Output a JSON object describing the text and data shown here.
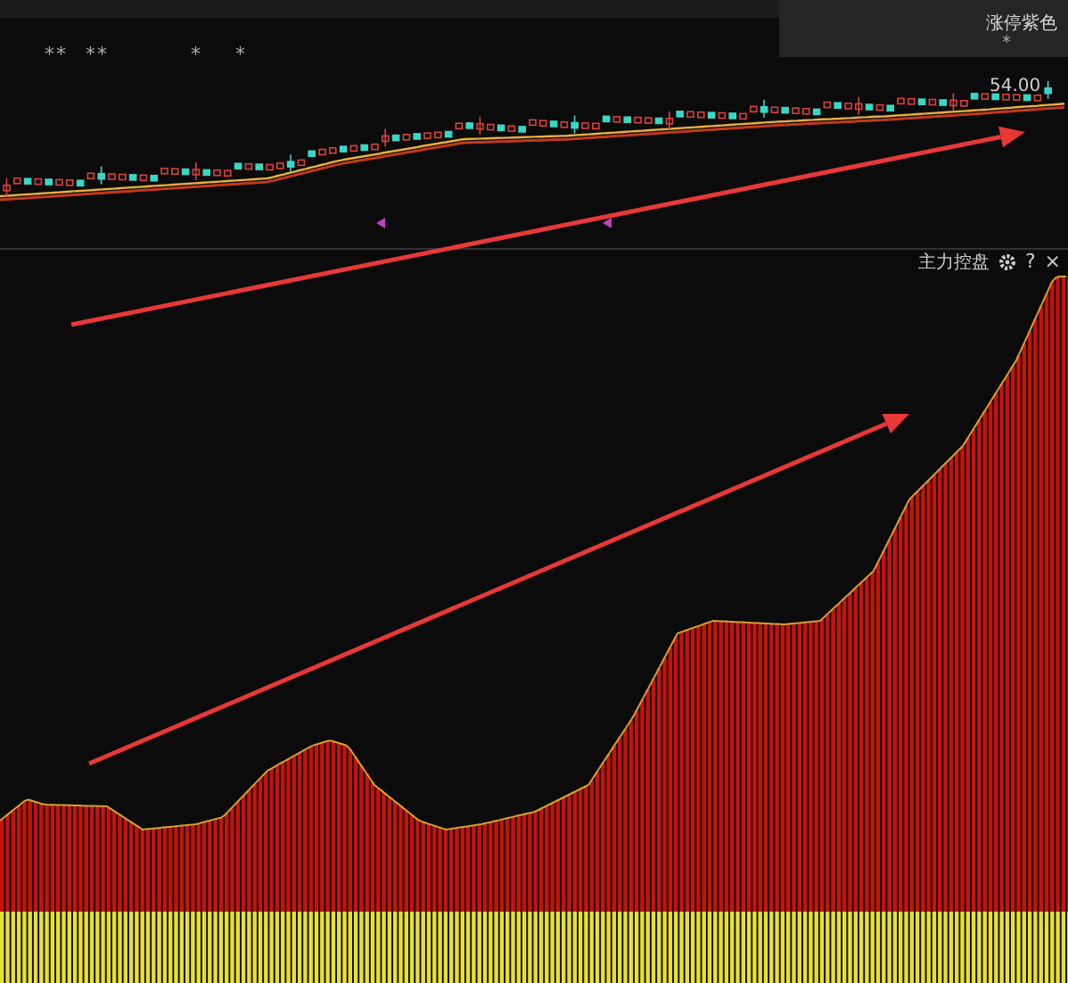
{
  "price_panel": {
    "signal_marks": [
      "**",
      "**",
      "*",
      "*"
    ],
    "legend": {
      "label": "涨停紫色",
      "mark": "*"
    },
    "price_label": "54.00"
  },
  "indicator_panel": {
    "title": "主力控盘",
    "help": "?",
    "close": "×"
  }
}
